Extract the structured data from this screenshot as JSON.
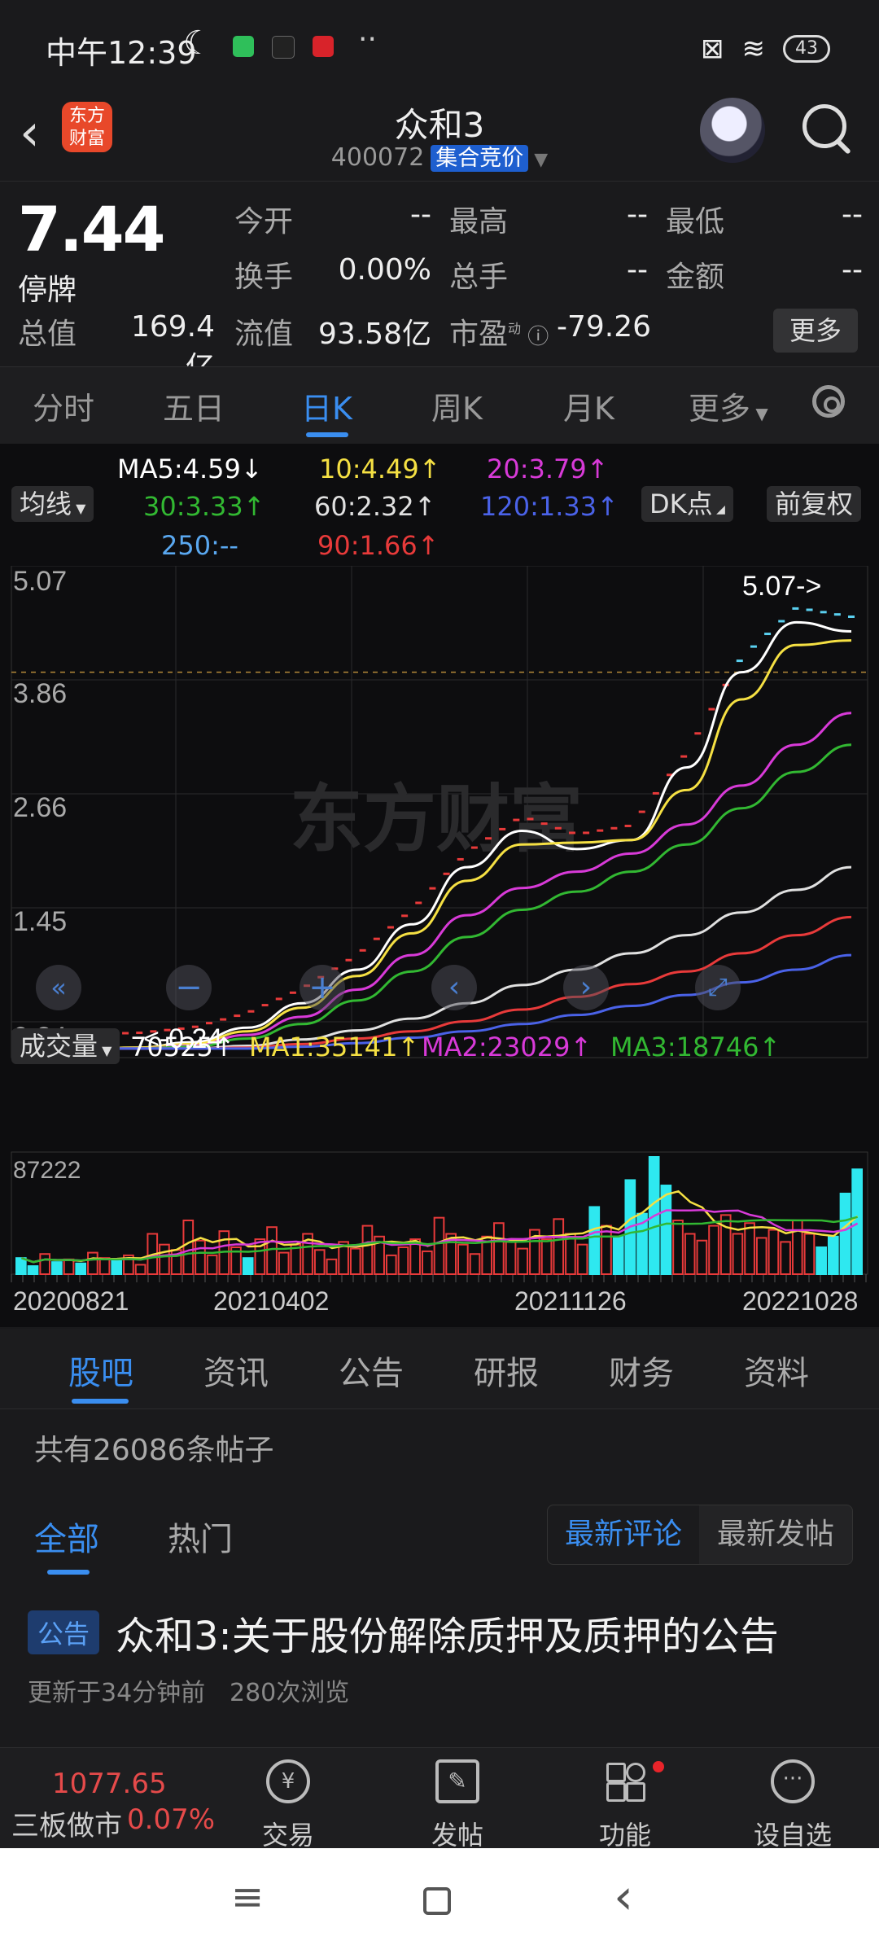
{
  "status_bar": {
    "time": "中午12:39",
    "battery": "43"
  },
  "header": {
    "title": "众和3",
    "code": "400072",
    "tag": "集合竞价",
    "logo_text": "东方财富"
  },
  "quote": {
    "price": "7.44",
    "status": "停牌",
    "fields": [
      {
        "label": "今开",
        "value": "--"
      },
      {
        "label": "最高",
        "value": "--"
      },
      {
        "label": "最低",
        "value": "--"
      },
      {
        "label": "换手",
        "value": "0.00%"
      },
      {
        "label": "总手",
        "value": "--"
      },
      {
        "label": "金额",
        "value": "--"
      },
      {
        "label": "总值",
        "value": "169.4亿"
      },
      {
        "label": "流值",
        "value": "93.58亿"
      },
      {
        "label": "市盈",
        "value": "-79.26"
      }
    ],
    "pe_sup": "动",
    "more": "更多"
  },
  "period_tabs": [
    "分时",
    "五日",
    "日K",
    "周K",
    "月K",
    "更多"
  ],
  "ma_controls": {
    "select": "均线",
    "dk": "DK点",
    "adjust": "前复权"
  },
  "ma_values": [
    {
      "text": "MA5:4.59",
      "arrow": "↓",
      "color": "#ffffff"
    },
    {
      "text": "10:4.49",
      "arrow": "↑",
      "color": "#f5e043"
    },
    {
      "text": "20:3.79",
      "arrow": "↑",
      "color": "#d83ad8"
    },
    {
      "text": "30:3.33",
      "arrow": "↑",
      "color": "#32b832"
    },
    {
      "text": "60:2.32",
      "arrow": "↑",
      "color": "#e0e0e0"
    },
    {
      "text": "120:1.33",
      "arrow": "↑",
      "color": "#4a62e8"
    },
    {
      "text": "250:--",
      "arrow": "",
      "color": "#5aa8f0"
    },
    {
      "text": "90:1.66",
      "arrow": "↑",
      "color": "#e83a3a"
    }
  ],
  "chart_data": [
    {
      "type": "line",
      "y_ticks": [
        "5.07",
        "3.86",
        "2.66",
        "1.45",
        "0.24"
      ],
      "ylim": [
        0.24,
        5.07
      ],
      "high_label": "5.07->",
      "low_label": "<-0.24",
      "last_price_line": 4.4,
      "watermark": "东方财富",
      "series": [
        {
          "color": "#ffffff",
          "values": [
            0.25,
            0.25,
            0.26,
            0.32,
            0.48,
            0.75,
            1.12,
            1.62,
            2.25,
            2.65,
            2.45,
            2.55,
            3.35,
            4.4,
            4.95,
            4.85
          ]
        },
        {
          "color": "#f5e043",
          "values": [
            0.25,
            0.25,
            0.26,
            0.3,
            0.44,
            0.7,
            1.05,
            1.52,
            2.1,
            2.5,
            2.52,
            2.55,
            3.1,
            4.1,
            4.7,
            4.75
          ]
        },
        {
          "color": "#d83ad8",
          "values": [
            0.25,
            0.25,
            0.25,
            0.28,
            0.4,
            0.6,
            0.9,
            1.28,
            1.72,
            2.02,
            2.2,
            2.4,
            2.72,
            3.15,
            3.6,
            3.95
          ]
        },
        {
          "color": "#32b832",
          "values": [
            0.25,
            0.25,
            0.25,
            0.27,
            0.36,
            0.52,
            0.78,
            1.1,
            1.48,
            1.78,
            1.98,
            2.2,
            2.5,
            2.9,
            3.3,
            3.6
          ]
        },
        {
          "color": "#e0e0e0",
          "values": [
            0.25,
            0.25,
            0.25,
            0.25,
            0.28,
            0.35,
            0.45,
            0.58,
            0.75,
            0.95,
            1.12,
            1.3,
            1.5,
            1.75,
            2.0,
            2.25
          ]
        },
        {
          "color": "#e83a3a",
          "values": [
            0.25,
            0.25,
            0.25,
            0.25,
            0.26,
            0.3,
            0.36,
            0.44,
            0.55,
            0.68,
            0.82,
            0.96,
            1.1,
            1.3,
            1.5,
            1.7
          ]
        },
        {
          "color": "#4a62e8",
          "values": [
            0.25,
            0.25,
            0.25,
            0.25,
            0.25,
            0.27,
            0.31,
            0.37,
            0.44,
            0.52,
            0.62,
            0.72,
            0.84,
            0.98,
            1.12,
            1.28
          ]
        }
      ]
    },
    {
      "type": "bar",
      "label": "成交量",
      "legend": [
        {
          "text": "70525",
          "arrow": "↑",
          "color": "#ffffff"
        },
        {
          "text": "MA1:35141",
          "arrow": "↑",
          "color": "#f5e043"
        },
        {
          "text": "MA2:23029",
          "arrow": "↑",
          "color": "#d83ad8"
        },
        {
          "text": "MA3:18746",
          "arrow": "↑",
          "color": "#32b832"
        }
      ],
      "y_tick": "87222",
      "ylim": [
        0,
        87222
      ],
      "x_ticks": [
        "20200821",
        "20210402",
        "20211126",
        "20221028"
      ],
      "values": [
        12000,
        6000,
        15000,
        9000,
        11000,
        8000,
        16000,
        12000,
        10000,
        14000,
        7000,
        30000,
        22000,
        18000,
        40000,
        25000,
        14000,
        32000,
        20000,
        12000,
        26000,
        35000,
        16000,
        22000,
        30000,
        18000,
        11000,
        24000,
        19000,
        36000,
        28000,
        14000,
        20000,
        26000,
        17000,
        42000,
        30000,
        22000,
        15000,
        28000,
        38000,
        24000,
        19000,
        33000,
        26000,
        41000,
        30000,
        22000,
        50000,
        36000,
        28000,
        70000,
        45000,
        87222,
        66000,
        40000,
        30000,
        25000,
        36000,
        44000,
        30000,
        38000,
        27000,
        33000,
        24000,
        40000,
        30000,
        20000,
        28000,
        60000,
        78000
      ],
      "colors": [
        "c",
        "c",
        "r",
        "c",
        "r",
        "c",
        "r",
        "r",
        "c",
        "r",
        "r",
        "r",
        "r",
        "r",
        "r",
        "r",
        "r",
        "r",
        "r",
        "c",
        "r",
        "r",
        "r",
        "r",
        "r",
        "r",
        "r",
        "r",
        "r",
        "r",
        "r",
        "r",
        "r",
        "r",
        "r",
        "r",
        "r",
        "r",
        "r",
        "r",
        "r",
        "r",
        "r",
        "r",
        "r",
        "r",
        "r",
        "r",
        "c",
        "r",
        "c",
        "c",
        "c",
        "c",
        "c",
        "r",
        "r",
        "r",
        "r",
        "r",
        "r",
        "r",
        "r",
        "r",
        "r",
        "r",
        "r",
        "c",
        "c",
        "c",
        "c"
      ]
    }
  ],
  "sub_tabs": [
    "股吧",
    "资讯",
    "公告",
    "研报",
    "财务",
    "资料"
  ],
  "post_count": "共有26086条帖子",
  "filter_tabs": [
    "全部",
    "热门"
  ],
  "sort_options": [
    "最新评论",
    "最新发帖"
  ],
  "post": {
    "badge": "公告",
    "title": "众和3:关于股份解除质押及质押的公告",
    "updated": "更新于34分钟前",
    "views": "280次浏览"
  },
  "bottom_bar": {
    "index_value": "1077.65",
    "index_name": "三板做市",
    "index_pct": "0.07%",
    "items": [
      "交易",
      "发帖",
      "功能",
      "设自选"
    ]
  }
}
